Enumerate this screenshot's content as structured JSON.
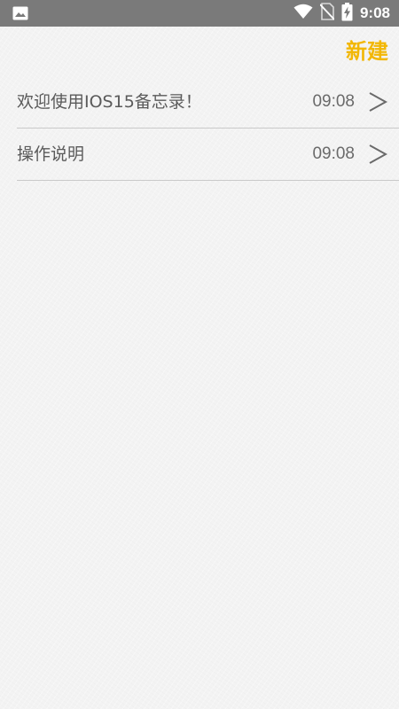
{
  "status_bar": {
    "time": "9:08",
    "left_icon": "image-icon",
    "icons": [
      "wifi-icon",
      "no-sim-icon",
      "battery-charging-icon"
    ]
  },
  "header": {
    "new_label": "新建"
  },
  "notes": [
    {
      "title": "欢迎使用IOS15备忘录！",
      "time": "09:08"
    },
    {
      "title": "操作说明",
      "time": "09:08"
    }
  ],
  "colors": {
    "accent": "#f2b705",
    "status_bar": "#7a7a7a",
    "background": "#f3f3f3",
    "divider": "#c9c9c9"
  }
}
